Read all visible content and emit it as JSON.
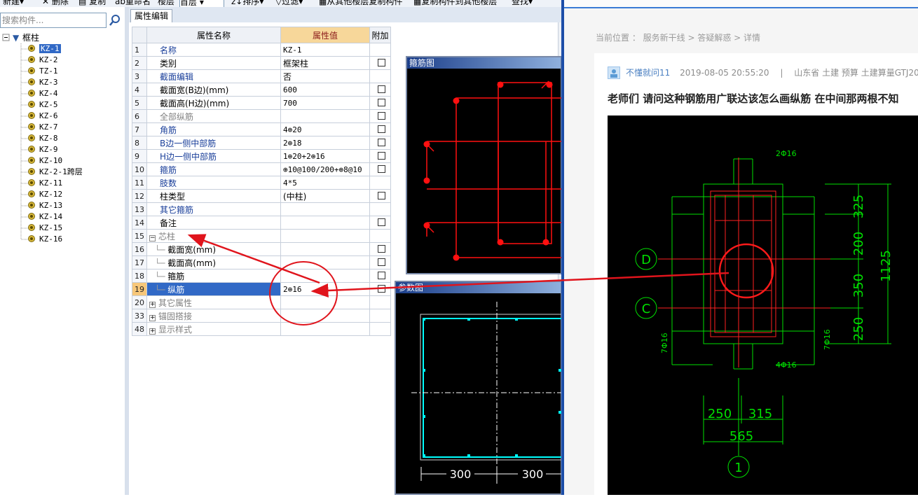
{
  "toolbar": {
    "new": "新建",
    "delete": "删除",
    "copy": "复制",
    "rename": "重命名",
    "floor_label": "楼层",
    "floor_value": "首层",
    "sort": "排序",
    "filter": "过滤",
    "copy_from_floor": "从其他楼层复制构件",
    "copy_to_floor": "复制构件到其他楼层",
    "find": "查找"
  },
  "left": {
    "search_placeholder": "搜索构件...",
    "root": "框柱",
    "items": [
      "KZ-1",
      "KZ-2",
      "TZ-1",
      "KZ-3",
      "KZ-4",
      "KZ-5",
      "KZ-6",
      "KZ-7",
      "KZ-8",
      "KZ-9",
      "KZ-10",
      "KZ-2-1跨层",
      "KZ-11",
      "KZ-12",
      "KZ-13",
      "KZ-14",
      "KZ-15",
      "KZ-16"
    ]
  },
  "props": {
    "tab": "属性编辑",
    "header": {
      "name": "属性名称",
      "value": "属性值",
      "extra": "附加"
    },
    "rows": [
      {
        "idx": "1",
        "name": "名称",
        "value": "KZ-1"
      },
      {
        "idx": "2",
        "name": "类别",
        "value": "框架柱"
      },
      {
        "idx": "3",
        "name": "截面编辑",
        "value": "否"
      },
      {
        "idx": "4",
        "name": "截面宽(B边)(mm)",
        "value": "600"
      },
      {
        "idx": "5",
        "name": "截面高(H边)(mm)",
        "value": "700"
      },
      {
        "idx": "6",
        "name": "全部纵筋",
        "value": ""
      },
      {
        "idx": "7",
        "name": "角筋",
        "value": "4⊕20"
      },
      {
        "idx": "8",
        "name": "B边一侧中部筋",
        "value": "2⊕18"
      },
      {
        "idx": "9",
        "name": "H边一侧中部筋",
        "value": "1⊕20+2⊕16"
      },
      {
        "idx": "10",
        "name": "箍筋",
        "value": "⊕10@100/200+⊕8@10"
      },
      {
        "idx": "11",
        "name": "肢数",
        "value": "4*5"
      },
      {
        "idx": "12",
        "name": "柱类型",
        "value": "(中柱)"
      },
      {
        "idx": "13",
        "name": "其它箍筋",
        "value": ""
      },
      {
        "idx": "14",
        "name": "备注",
        "value": ""
      },
      {
        "idx": "15",
        "name": "芯柱",
        "value": ""
      },
      {
        "idx": "16",
        "name": "截面宽(mm)",
        "value": ""
      },
      {
        "idx": "17",
        "name": "截面高(mm)",
        "value": ""
      },
      {
        "idx": "18",
        "name": "箍筋",
        "value": ""
      },
      {
        "idx": "19",
        "name": "纵筋",
        "value": "2⊕16"
      },
      {
        "idx": "20",
        "name": "其它属性",
        "value": ""
      },
      {
        "idx": "33",
        "name": "锚固搭接",
        "value": ""
      },
      {
        "idx": "48",
        "name": "显示样式",
        "value": ""
      }
    ]
  },
  "popups": {
    "stirrup_title": "箍筋图",
    "param_title": "参数图",
    "dim_left": "300",
    "dim_right": "300"
  },
  "right": {
    "breadcrumb": "当前位置 ： 服务新干线 > 答疑解惑 > 详情",
    "author": "不懂就问11",
    "date": "2019-08-05 20:55:20",
    "sep": "|",
    "tags": "山东省  土建  预算  土建算量GTJ20",
    "title": "老师们 请问这种钢筋用广联达该怎么画纵筋 在中间那两根不知",
    "cad": {
      "top_bar": "2Φ16",
      "bottom_bar": "4Φ16",
      "left_bar": "7Φ16",
      "right_bar": "7Φ16",
      "axis_d": "D",
      "axis_c": "C",
      "axis_1": "1",
      "dim_325": "325",
      "dim_200": "200",
      "dim_350": "350",
      "dim_250v": "250",
      "dim_1125": "1125",
      "dim_250h": "250",
      "dim_315": "315",
      "dim_565": "565"
    }
  },
  "colors": {
    "arrow": "#e0141c",
    "cad_green": "#00ff00",
    "cad_red": "#ff2020",
    "param_cyan": "#00ffff"
  }
}
